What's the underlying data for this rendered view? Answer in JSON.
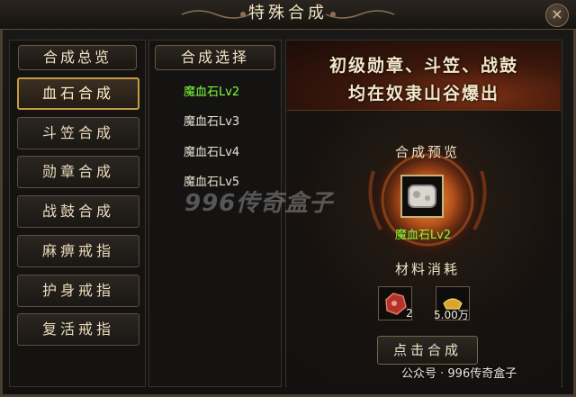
{
  "window": {
    "title": "特殊合成",
    "close_label": "×"
  },
  "left_panel": {
    "heading": "合成总览",
    "items": [
      {
        "label": "血石合成",
        "active": true
      },
      {
        "label": "斗笠合成",
        "active": false
      },
      {
        "label": "勋章合成",
        "active": false
      },
      {
        "label": "战鼓合成",
        "active": false
      },
      {
        "label": "麻痹戒指",
        "active": false
      },
      {
        "label": "护身戒指",
        "active": false
      },
      {
        "label": "复活戒指",
        "active": false
      }
    ]
  },
  "middle_panel": {
    "heading": "合成选择",
    "recipes": [
      {
        "label": "魔血石Lv2",
        "selected": true
      },
      {
        "label": "魔血石Lv3",
        "selected": false
      },
      {
        "label": "魔血石Lv4",
        "selected": false
      },
      {
        "label": "魔血石Lv5",
        "selected": false
      }
    ]
  },
  "banner": {
    "line1": "初级勋章、斗笠、战鼓",
    "line2": "均在奴隶山谷爆出"
  },
  "preview": {
    "heading": "合成预览",
    "item_name": "魔血石Lv2",
    "item_icon": "blood-stone-icon",
    "item_name_color": "#7dff3a"
  },
  "materials": {
    "heading": "材料消耗",
    "items": [
      {
        "icon": "red-stone-icon",
        "count": "2"
      },
      {
        "icon": "gold-ingot-icon",
        "count": "5.00万"
      }
    ]
  },
  "confirm_button": "点击合成",
  "watermarks": {
    "center": "996传奇盒子",
    "corner": "公众号 · 996传奇盒子"
  },
  "colors": {
    "accent_gold": "#c79b43",
    "selected_green": "#7dff3a",
    "text_light": "#efe2c4"
  }
}
